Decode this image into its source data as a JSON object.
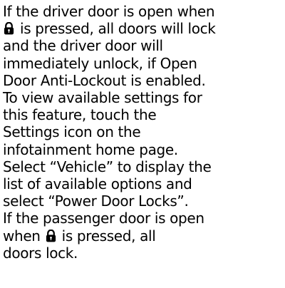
{
  "document": {
    "paragraph1": {
      "line1": "If the driver door is open when",
      "line2_after_icon": " is pressed, all doors will lock",
      "line3": "and the driver door will",
      "line4": "immediately unlock, if Open",
      "line5": "Door Anti-Lockout is enabled.",
      "line6": "To view available settings for",
      "line7": "this feature, touch the",
      "line8": "Settings icon on the",
      "line9": "infotainment home page.",
      "line10": "Select “Vehicle” to display the",
      "line11": "list of available options and",
      "line12": "select “Power Door Locks”."
    },
    "paragraph2": {
      "line1": "If the passenger door is open",
      "line2_before_icon": "when ",
      "line2_after_icon": " is pressed, all",
      "line3": "doors lock."
    },
    "icons": {
      "lock_icon": "lock-icon"
    }
  }
}
